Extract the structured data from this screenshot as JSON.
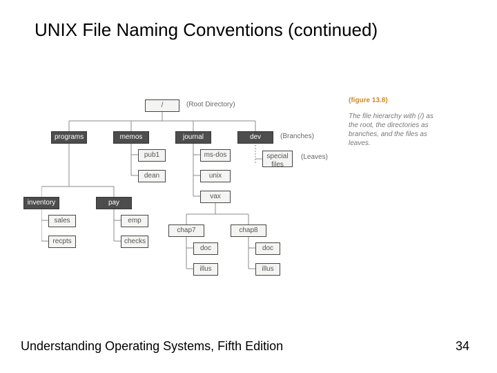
{
  "slide": {
    "title": "UNIX File Naming Conventions (continued)",
    "footer_left": "Understanding Operating Systems, Fifth Edition",
    "page_number": "34"
  },
  "figure": {
    "ref": "(figure 13.8)",
    "caption": "The file hierarchy with (/) as the root, the directories as branches, and the files as leaves.",
    "root_annot": "(Root Directory)",
    "branches_annot": "(Branches)",
    "leaves_annot": "(Leaves)"
  },
  "tree": {
    "root": "/",
    "level1": {
      "programs": "programs",
      "memos": "memos",
      "journal": "journal",
      "dev": "dev"
    },
    "memos_children": {
      "pub1": "pub1",
      "dean": "dean"
    },
    "journal_children": {
      "msdos": "ms-dos",
      "unix": "unix",
      "vax": "vax"
    },
    "dev_children": {
      "special": "special files"
    },
    "programs_children": {
      "inventory": "inventory",
      "pay": "pay"
    },
    "inventory_children": {
      "sales": "sales",
      "recpts": "recpts"
    },
    "pay_children": {
      "emp": "emp",
      "checks": "checks"
    },
    "vax_children": {
      "chap7": "chap7",
      "chap8": "chap8"
    },
    "chap7_children": {
      "doc": "doc",
      "illus": "illus"
    },
    "chap8_children": {
      "doc": "doc",
      "illus": "illus"
    }
  }
}
